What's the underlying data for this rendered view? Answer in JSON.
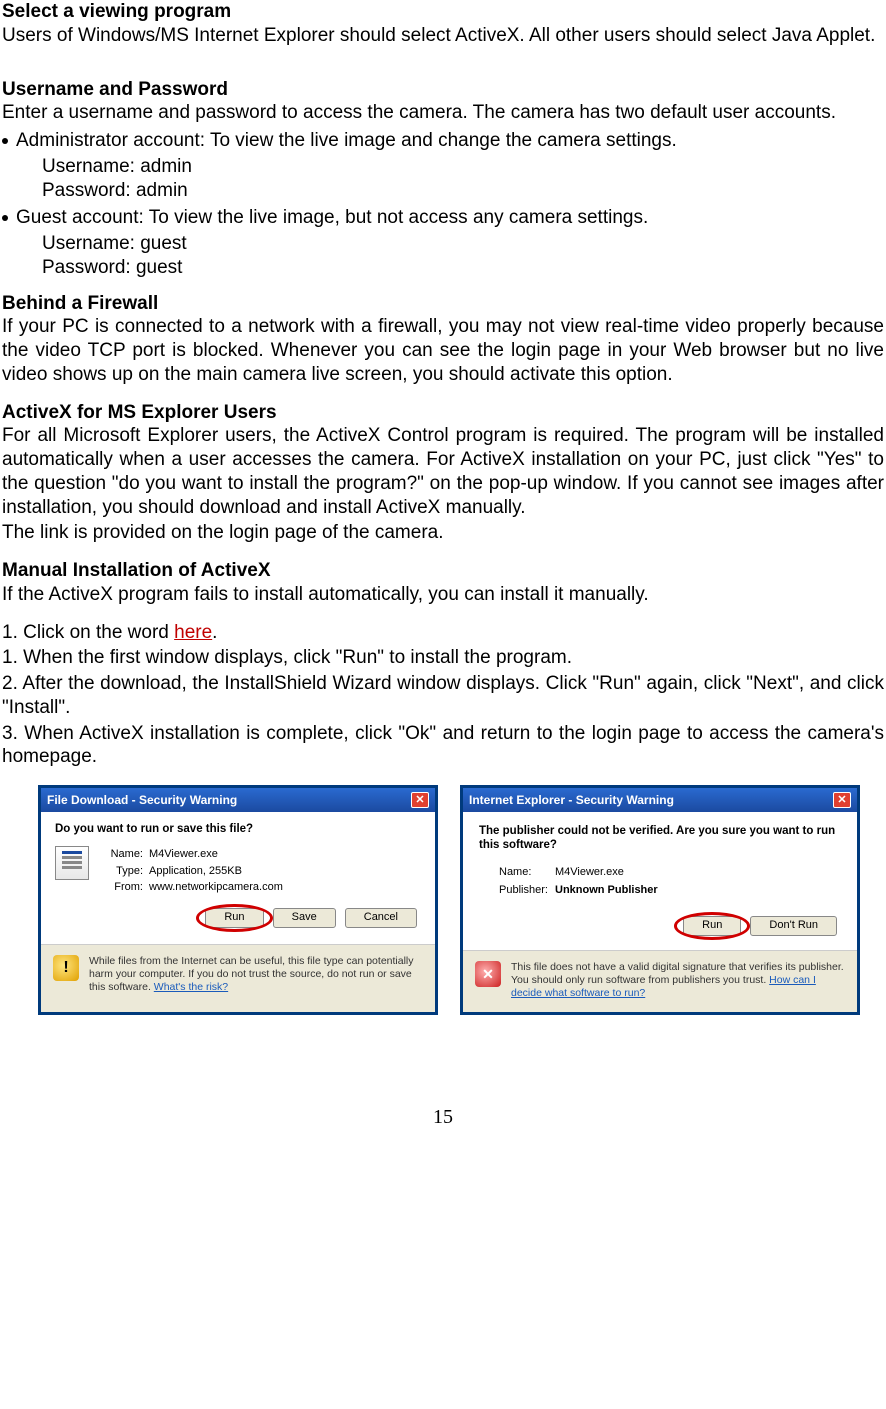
{
  "s1": {
    "title": "Select a viewing program",
    "body": "Users of Windows/MS Internet Explorer should select ActiveX. All other users should select Java Applet."
  },
  "s2": {
    "title": "Username and Password",
    "body": "Enter a username and password to access the camera. The camera has two default user accounts.",
    "accounts": [
      {
        "head": "Administrator account: To view the live image and change the camera settings.",
        "user": "Username: admin",
        "pass": "Password: admin"
      },
      {
        "head": "Guest account: To view the live image, but not access any camera settings.",
        "user": "Username: guest",
        "pass": "Password: guest"
      }
    ]
  },
  "s3": {
    "title": "Behind a Firewall",
    "body": "If your PC is connected to a network with a firewall, you may not view real-time video properly because the video TCP port is blocked. Whenever you can see the login page in your Web browser but no live video shows up on the main camera live screen, you should activate this option."
  },
  "s4": {
    "title": "ActiveX for MS Explorer Users",
    "body": "For all Microsoft Explorer users, the ActiveX Control program is required. The program will be installed automatically when a user accesses the camera. For ActiveX installation on your PC, just click \"Yes\" to the question \"do you want to install the program?\" on the pop-up window. If you cannot see images after installation, you should download and install ActiveX manually.",
    "body2": "The link is provided on the login page of the camera."
  },
  "s5": {
    "title": "Manual Installation of ActiveX",
    "intro": "If the ActiveX program fails to install automatically, you can install it manually.",
    "steps": [
      {
        "pre": "1. Click on the word ",
        "link": "here",
        "post": "."
      },
      "1. When the first window displays, click \"Run\" to install the program.",
      "2. After the download, the InstallShield Wizard window displays. Click \"Run\" again, click \"Next\", and click \"Install\".",
      "3. When ActiveX installation is complete, click \"Ok\" and return to the login page to access the camera's homepage."
    ]
  },
  "dlg1": {
    "title": "File Download - Security Warning",
    "question": "Do you want to run or save this file?",
    "name_lbl": "Name:",
    "name": "M4Viewer.exe",
    "type_lbl": "Type:",
    "type": "Application, 255KB",
    "from_lbl": "From:",
    "from": "www.networkipcamera.com",
    "run": "Run",
    "save": "Save",
    "cancel": "Cancel",
    "foot": "While files from the Internet can be useful, this file type can potentially harm your computer. If you do not trust the source, do not run or save this software. ",
    "foot_link": "What's the risk?"
  },
  "dlg2": {
    "title": "Internet Explorer - Security Warning",
    "question": "The publisher could not be verified.  Are you sure you want to run this software?",
    "name_lbl": "Name:",
    "name": "M4Viewer.exe",
    "pub_lbl": "Publisher:",
    "pub": "Unknown Publisher",
    "run": "Run",
    "dont": "Don't Run",
    "foot": "This file does not have a valid digital signature that verifies its publisher. You should only run software from publishers you trust. ",
    "foot_link": "How can I decide what software to run?"
  },
  "page_number": "15"
}
